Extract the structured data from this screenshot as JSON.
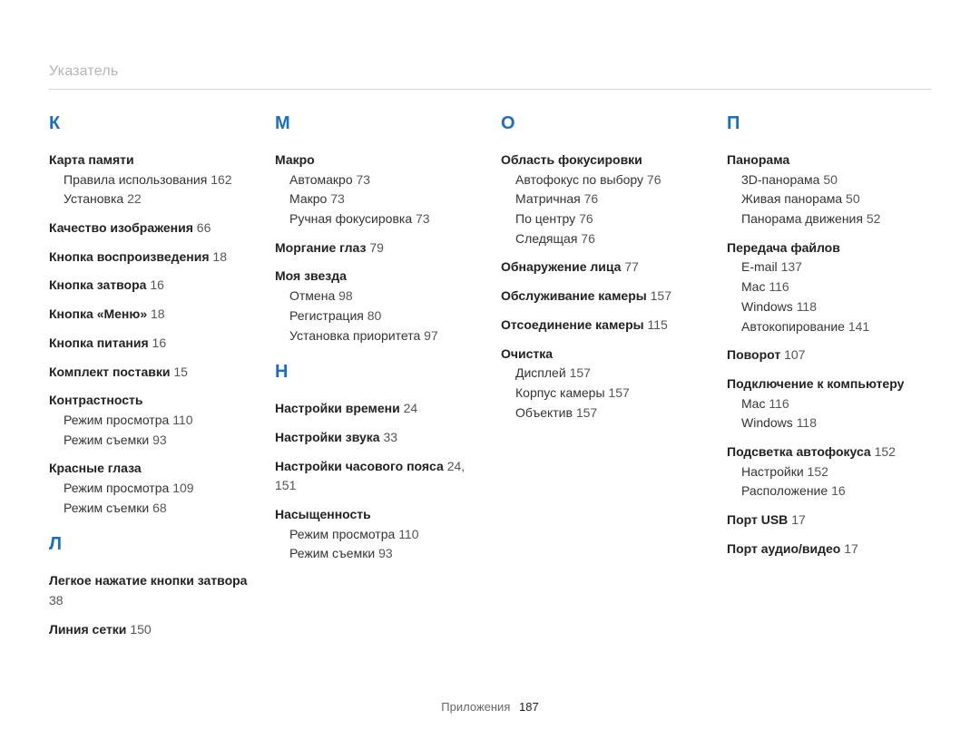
{
  "breadcrumb": "Указатель",
  "footer": {
    "label": "Приложения",
    "page": "187"
  },
  "columns": [
    [
      {
        "letter": "К",
        "entries": [
          {
            "title": "Карта памяти",
            "subs": [
              {
                "text": "Правила использования",
                "page": "162"
              },
              {
                "text": "Установка",
                "page": "22"
              }
            ]
          },
          {
            "title": "Качество изображения",
            "page": "66"
          },
          {
            "title": "Кнопка воспроизведения",
            "page": "18"
          },
          {
            "title": "Кнопка затвора",
            "page": "16"
          },
          {
            "title": "Кнопка «Меню»",
            "page": "18"
          },
          {
            "title": "Кнопка питания",
            "page": "16"
          },
          {
            "title": "Комплект поставки",
            "page": "15"
          },
          {
            "title": "Контрастность",
            "subs": [
              {
                "text": "Режим просмотра",
                "page": "110"
              },
              {
                "text": "Режим съемки",
                "page": "93"
              }
            ]
          },
          {
            "title": "Красные глаза",
            "subs": [
              {
                "text": "Режим просмотра",
                "page": "109"
              },
              {
                "text": "Режим съемки",
                "page": "68"
              }
            ]
          }
        ]
      }
    ],
    [
      {
        "letter": "Л",
        "entries": [
          {
            "title": "Легкое нажатие кнопки затвора",
            "page": "38"
          },
          {
            "title": "Линия сетки",
            "page": "150"
          }
        ]
      },
      {
        "letter": "М",
        "entries": [
          {
            "title": "Макро",
            "subs": [
              {
                "text": "Автомакро",
                "page": "73"
              },
              {
                "text": "Макро",
                "page": "73"
              },
              {
                "text": "Ручная фокусировка",
                "page": "73"
              }
            ]
          },
          {
            "title": "Моргание глаз",
            "page": "79"
          },
          {
            "title": "Моя звезда",
            "subs": [
              {
                "text": "Отмена",
                "page": "98"
              },
              {
                "text": "Регистрация",
                "page": "80"
              },
              {
                "text": "Установка приоритета",
                "page": "97"
              }
            ]
          }
        ]
      }
    ],
    [
      {
        "letter": "Н",
        "entries": [
          {
            "title": "Настройки времени",
            "page": "24"
          },
          {
            "title": "Настройки звука",
            "page": "33"
          },
          {
            "title": "Настройки часового пояса",
            "page": "24, 151"
          },
          {
            "title": "Насыщенность",
            "subs": [
              {
                "text": "Режим просмотра",
                "page": "110"
              },
              {
                "text": "Режим съемки",
                "page": "93"
              }
            ]
          }
        ]
      },
      {
        "letter": "О",
        "entries": [
          {
            "title": "Область фокусировки",
            "subs": [
              {
                "text": "Автофокус по выбору",
                "page": "76"
              },
              {
                "text": "Матричная",
                "page": "76"
              },
              {
                "text": "По центру",
                "page": "76"
              },
              {
                "text": "Следящая",
                "page": "76"
              }
            ]
          },
          {
            "title": "Обнаружение лица",
            "page": "77"
          },
          {
            "title": "Обслуживание камеры",
            "page": "157"
          },
          {
            "title": "Отсоединение камеры",
            "page": "115"
          },
          {
            "title": "Очистка",
            "subs": [
              {
                "text": "Дисплей",
                "page": "157"
              },
              {
                "text": "Корпус камеры",
                "page": "157"
              },
              {
                "text": "Объектив",
                "page": "157"
              }
            ]
          }
        ]
      }
    ],
    [
      {
        "letter": "П",
        "entries": [
          {
            "title": "Панорама",
            "subs": [
              {
                "text": "3D-панорама",
                "page": "50"
              },
              {
                "text": "Живая панорама",
                "page": "50"
              },
              {
                "text": "Панорама движения",
                "page": "52"
              }
            ]
          },
          {
            "title": "Передача файлов",
            "subs": [
              {
                "text": "E-mail",
                "page": "137"
              },
              {
                "text": "Mac",
                "page": "116"
              },
              {
                "text": "Windows",
                "page": "118"
              },
              {
                "text": "Автокопирование",
                "page": "141"
              }
            ]
          },
          {
            "title": "Поворот",
            "page": "107"
          },
          {
            "title": "Подключение к компьютеру",
            "subs": [
              {
                "text": "Mac",
                "page": "116"
              },
              {
                "text": "Windows",
                "page": "118"
              }
            ]
          },
          {
            "title": "Подсветка автофокуса",
            "page": "152",
            "subs": [
              {
                "text": "Настройки",
                "page": "152"
              },
              {
                "text": "Расположение",
                "page": "16"
              }
            ]
          },
          {
            "title": "Порт USB",
            "page": "17"
          },
          {
            "title": "Порт аудио/видео",
            "page": "17"
          }
        ]
      }
    ]
  ]
}
